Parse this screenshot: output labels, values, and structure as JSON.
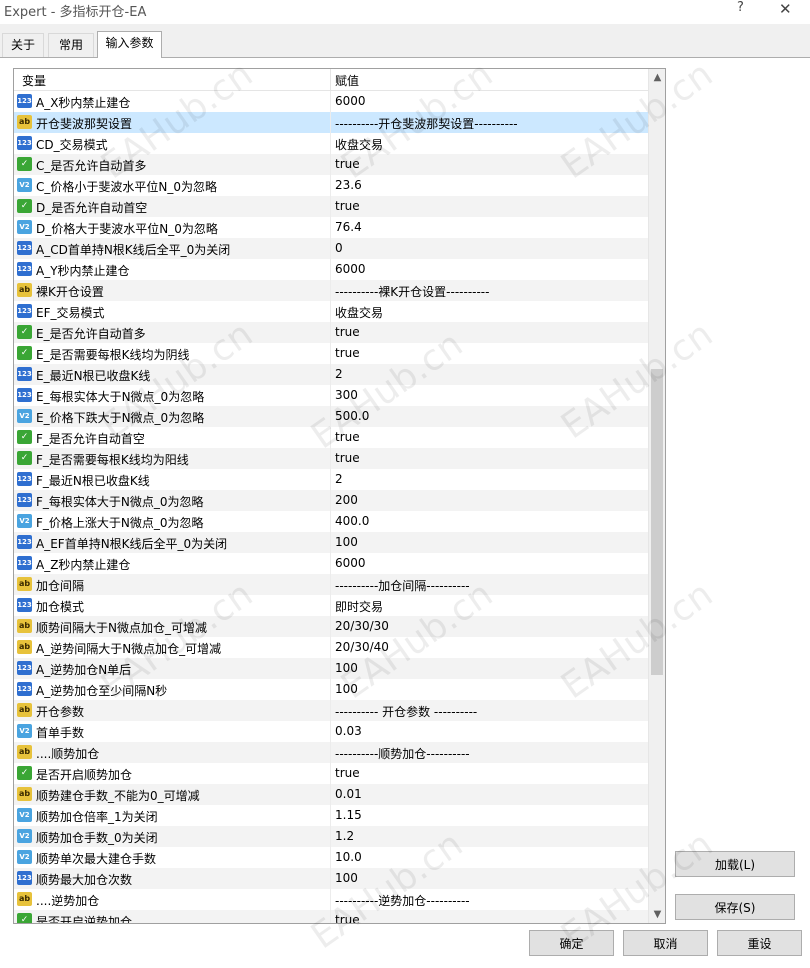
{
  "window": {
    "title": "Expert - 多指标开仓-EA",
    "help": "?",
    "close": "✕"
  },
  "tabs": [
    {
      "label": "关于"
    },
    {
      "label": "常用"
    },
    {
      "label": "输入参数"
    }
  ],
  "table": {
    "headers": {
      "variable": "变量",
      "value": "赋值"
    },
    "rows": [
      {
        "type": "int",
        "icon": "int-type-icon",
        "name": "A_X秒内禁止建仓",
        "value": "6000"
      },
      {
        "type": "str",
        "icon": "string-type-icon",
        "name": "开仓斐波那契设置",
        "value": "----------开仓斐波那契设置----------"
      },
      {
        "type": "int",
        "icon": "int-type-icon",
        "name": "CD_交易模式",
        "value": "收盘交易"
      },
      {
        "type": "bool",
        "icon": "bool-type-icon",
        "name": "C_是否允许自动首多",
        "value": "true"
      },
      {
        "type": "dbl",
        "icon": "double-type-icon",
        "name": "C_价格小于斐波水平位N_0为忽略",
        "value": "23.6"
      },
      {
        "type": "bool",
        "icon": "bool-type-icon",
        "name": "D_是否允许自动首空",
        "value": "true"
      },
      {
        "type": "dbl",
        "icon": "double-type-icon",
        "name": "D_价格大于斐波水平位N_0为忽略",
        "value": "76.4"
      },
      {
        "type": "int",
        "icon": "int-type-icon",
        "name": "A_CD首单持N根K线后全平_0为关闭",
        "value": "0"
      },
      {
        "type": "int",
        "icon": "int-type-icon",
        "name": "A_Y秒内禁止建仓",
        "value": "6000"
      },
      {
        "type": "str",
        "icon": "string-type-icon",
        "name": "裸K开仓设置",
        "value": "----------裸K开仓设置----------"
      },
      {
        "type": "int",
        "icon": "int-type-icon",
        "name": "EF_交易模式",
        "value": "收盘交易"
      },
      {
        "type": "bool",
        "icon": "bool-type-icon",
        "name": "E_是否允许自动首多",
        "value": "true"
      },
      {
        "type": "bool",
        "icon": "bool-type-icon",
        "name": "E_是否需要每根K线均为阴线",
        "value": "true"
      },
      {
        "type": "int",
        "icon": "int-type-icon",
        "name": "E_最近N根已收盘K线",
        "value": "2"
      },
      {
        "type": "int",
        "icon": "int-type-icon",
        "name": "E_每根实体大于N微点_0为忽略",
        "value": "300"
      },
      {
        "type": "dbl",
        "icon": "double-type-icon",
        "name": "E_价格下跌大于N微点_0为忽略",
        "value": "500.0"
      },
      {
        "type": "bool",
        "icon": "bool-type-icon",
        "name": "F_是否允许自动首空",
        "value": "true"
      },
      {
        "type": "bool",
        "icon": "bool-type-icon",
        "name": "F_是否需要每根K线均为阳线",
        "value": "true"
      },
      {
        "type": "int",
        "icon": "int-type-icon",
        "name": "F_最近N根已收盘K线",
        "value": "2"
      },
      {
        "type": "int",
        "icon": "int-type-icon",
        "name": "F_每根实体大于N微点_0为忽略",
        "value": "200"
      },
      {
        "type": "dbl",
        "icon": "double-type-icon",
        "name": "F_价格上涨大于N微点_0为忽略",
        "value": "400.0"
      },
      {
        "type": "int",
        "icon": "int-type-icon",
        "name": "A_EF首单持N根K线后全平_0为关闭",
        "value": "100"
      },
      {
        "type": "int",
        "icon": "int-type-icon",
        "name": "A_Z秒内禁止建仓",
        "value": "6000"
      },
      {
        "type": "str",
        "icon": "string-type-icon",
        "name": "加仓间隔",
        "value": "----------加仓间隔----------"
      },
      {
        "type": "int",
        "icon": "int-type-icon",
        "name": "加仓模式",
        "value": "即时交易"
      },
      {
        "type": "str",
        "icon": "string-type-icon",
        "name": "顺势间隔大于N微点加仓_可增减",
        "value": "20/30/30"
      },
      {
        "type": "str",
        "icon": "string-type-icon",
        "name": "A_逆势间隔大于N微点加仓_可增减",
        "value": "20/30/40"
      },
      {
        "type": "int",
        "icon": "int-type-icon",
        "name": "A_逆势加仓N单后",
        "value": "100"
      },
      {
        "type": "int",
        "icon": "int-type-icon",
        "name": "A_逆势加仓至少间隔N秒",
        "value": "100"
      },
      {
        "type": "str",
        "icon": "string-type-icon",
        "name": "开仓参数",
        "value": "---------- 开仓参数 ----------"
      },
      {
        "type": "dbl",
        "icon": "double-type-icon",
        "name": "首单手数",
        "value": "0.03"
      },
      {
        "type": "str",
        "icon": "string-type-icon",
        "name": "....顺势加仓",
        "value": "----------顺势加仓----------"
      },
      {
        "type": "bool",
        "icon": "bool-type-icon",
        "name": "是否开启顺势加仓",
        "value": "true"
      },
      {
        "type": "str",
        "icon": "string-type-icon",
        "name": "顺势建仓手数_不能为0_可增减",
        "value": "0.01"
      },
      {
        "type": "dbl",
        "icon": "double-type-icon",
        "name": "顺势加仓倍率_1为关闭",
        "value": "1.15"
      },
      {
        "type": "dbl",
        "icon": "double-type-icon",
        "name": "顺势加仓手数_0为关闭",
        "value": "1.2"
      },
      {
        "type": "dbl",
        "icon": "double-type-icon",
        "name": "顺势单次最大建仓手数",
        "value": "10.0"
      },
      {
        "type": "int",
        "icon": "int-type-icon",
        "name": "顺势最大加仓次数",
        "value": "100"
      },
      {
        "type": "str",
        "icon": "string-type-icon",
        "name": "....逆势加仓",
        "value": "----------逆势加仓----------"
      },
      {
        "type": "bool",
        "icon": "bool-type-icon",
        "name": "是否开启逆势加仓",
        "value": "true"
      }
    ],
    "selected_index": 1
  },
  "type_icons": {
    "int": "123",
    "str": "ab",
    "bool": "✓",
    "dbl": "V2"
  },
  "buttons": {
    "load": "加载(L)",
    "save": "保存(S)",
    "ok": "确定",
    "cancel": "取消",
    "reset": "重设"
  },
  "watermark": "EAHub.cn"
}
